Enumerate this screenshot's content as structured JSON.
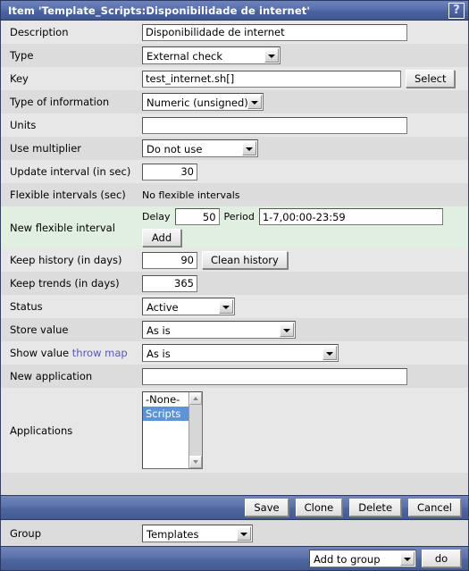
{
  "window": {
    "title": "Item 'Template_Scripts:Disponibilidade de internet'",
    "help_label": "?",
    "help_icon": "question-mark-icon"
  },
  "form": {
    "description": {
      "label": "Description",
      "value": "Disponibilidade de internet"
    },
    "type": {
      "label": "Type",
      "value": "External check"
    },
    "key": {
      "label": "Key",
      "value": "test_internet.sh[]",
      "select_button": "Select"
    },
    "type_of_information": {
      "label": "Type of information",
      "value": "Numeric (unsigned)"
    },
    "units": {
      "label": "Units",
      "value": ""
    },
    "use_multiplier": {
      "label": "Use multiplier",
      "value": "Do not use"
    },
    "update_interval": {
      "label": "Update interval (in sec)",
      "value": "30"
    },
    "flexible_intervals": {
      "label": "Flexible intervals (sec)",
      "value": "No flexible intervals"
    },
    "new_flexible_interval": {
      "label": "New flexible interval",
      "delay_label": "Delay",
      "delay_value": "50",
      "period_label": "Period",
      "period_value": "1-7,00:00-23:59",
      "add_button": "Add"
    },
    "keep_history": {
      "label": "Keep history (in days)",
      "value": "90",
      "clean_button": "Clean history"
    },
    "keep_trends": {
      "label": "Keep trends (in days)",
      "value": "365"
    },
    "status": {
      "label": "Status",
      "value": "Active"
    },
    "store_value": {
      "label": "Store value",
      "value": "As is"
    },
    "show_value": {
      "label": "Show value",
      "link_label": "throw map",
      "value": "As is"
    },
    "new_application": {
      "label": "New application",
      "value": ""
    },
    "applications": {
      "label": "Applications",
      "options": [
        "-None-",
        "Scripts"
      ],
      "selected": "Scripts"
    }
  },
  "actions": {
    "save": "Save",
    "clone": "Clone",
    "delete": "Delete",
    "cancel": "Cancel"
  },
  "group": {
    "label": "Group",
    "value": "Templates"
  },
  "bottom": {
    "action_value": "Add to group",
    "go_button": "do"
  },
  "colors": {
    "titlebar_blue": "#4f659e",
    "row_dark": "#dcdcdc",
    "row_light": "#e7e7e7",
    "row_green": "#e1efe1",
    "link": "#5a5ab0",
    "list_selection": "#5d94d6"
  }
}
